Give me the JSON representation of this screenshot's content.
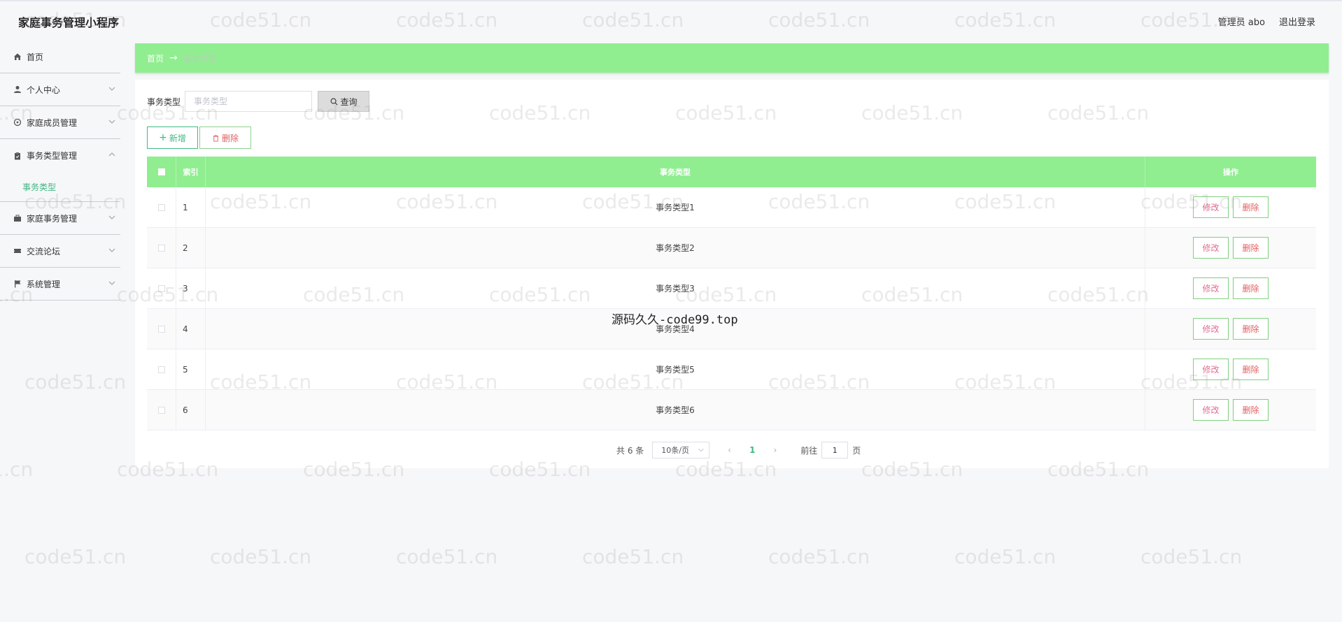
{
  "app": {
    "title": "家庭事务管理小程序"
  },
  "header": {
    "user": "管理员 abo",
    "logout": "退出登录"
  },
  "sidebar": {
    "items": [
      {
        "label": "首页",
        "icon": "home-icon"
      },
      {
        "label": "个人中心",
        "icon": "user-icon"
      },
      {
        "label": "家庭成员管理",
        "icon": "settings-icon"
      },
      {
        "label": "事务类型管理",
        "icon": "clipboard-icon",
        "expanded": true
      },
      {
        "label": "家庭事务管理",
        "icon": "briefcase-icon"
      },
      {
        "label": "交流论坛",
        "icon": "ticket-icon"
      },
      {
        "label": "系统管理",
        "icon": "flag-icon"
      }
    ],
    "submenu": {
      "label": "事务类型"
    }
  },
  "breadcrumb": {
    "home": "首页",
    "sep": "→",
    "current": "事务类型"
  },
  "search": {
    "label": "事务类型",
    "placeholder": "事务类型",
    "button": "查询"
  },
  "actions": {
    "add": "新增",
    "delete": "删除"
  },
  "table": {
    "headers": {
      "index": "索引",
      "type": "事务类型",
      "op": "操作"
    },
    "rows": [
      {
        "index": "1",
        "type": "事务类型1"
      },
      {
        "index": "2",
        "type": "事务类型2"
      },
      {
        "index": "3",
        "type": "事务类型3"
      },
      {
        "index": "4",
        "type": "事务类型4"
      },
      {
        "index": "5",
        "type": "事务类型5"
      },
      {
        "index": "6",
        "type": "事务类型6"
      }
    ],
    "edit_label": "修改",
    "delete_label": "删除"
  },
  "pagination": {
    "total": "共 6 条",
    "page_size": "10条/页",
    "current": "1",
    "goto_label": "前往",
    "goto_value": "1",
    "page_suffix": "页"
  },
  "overlay": {
    "text": "源码久久-code99.top"
  },
  "watermark": {
    "text": "code51.cn"
  },
  "colors": {
    "accent": "#90ee90",
    "primary": "#41b883",
    "danger": "#e06060"
  }
}
